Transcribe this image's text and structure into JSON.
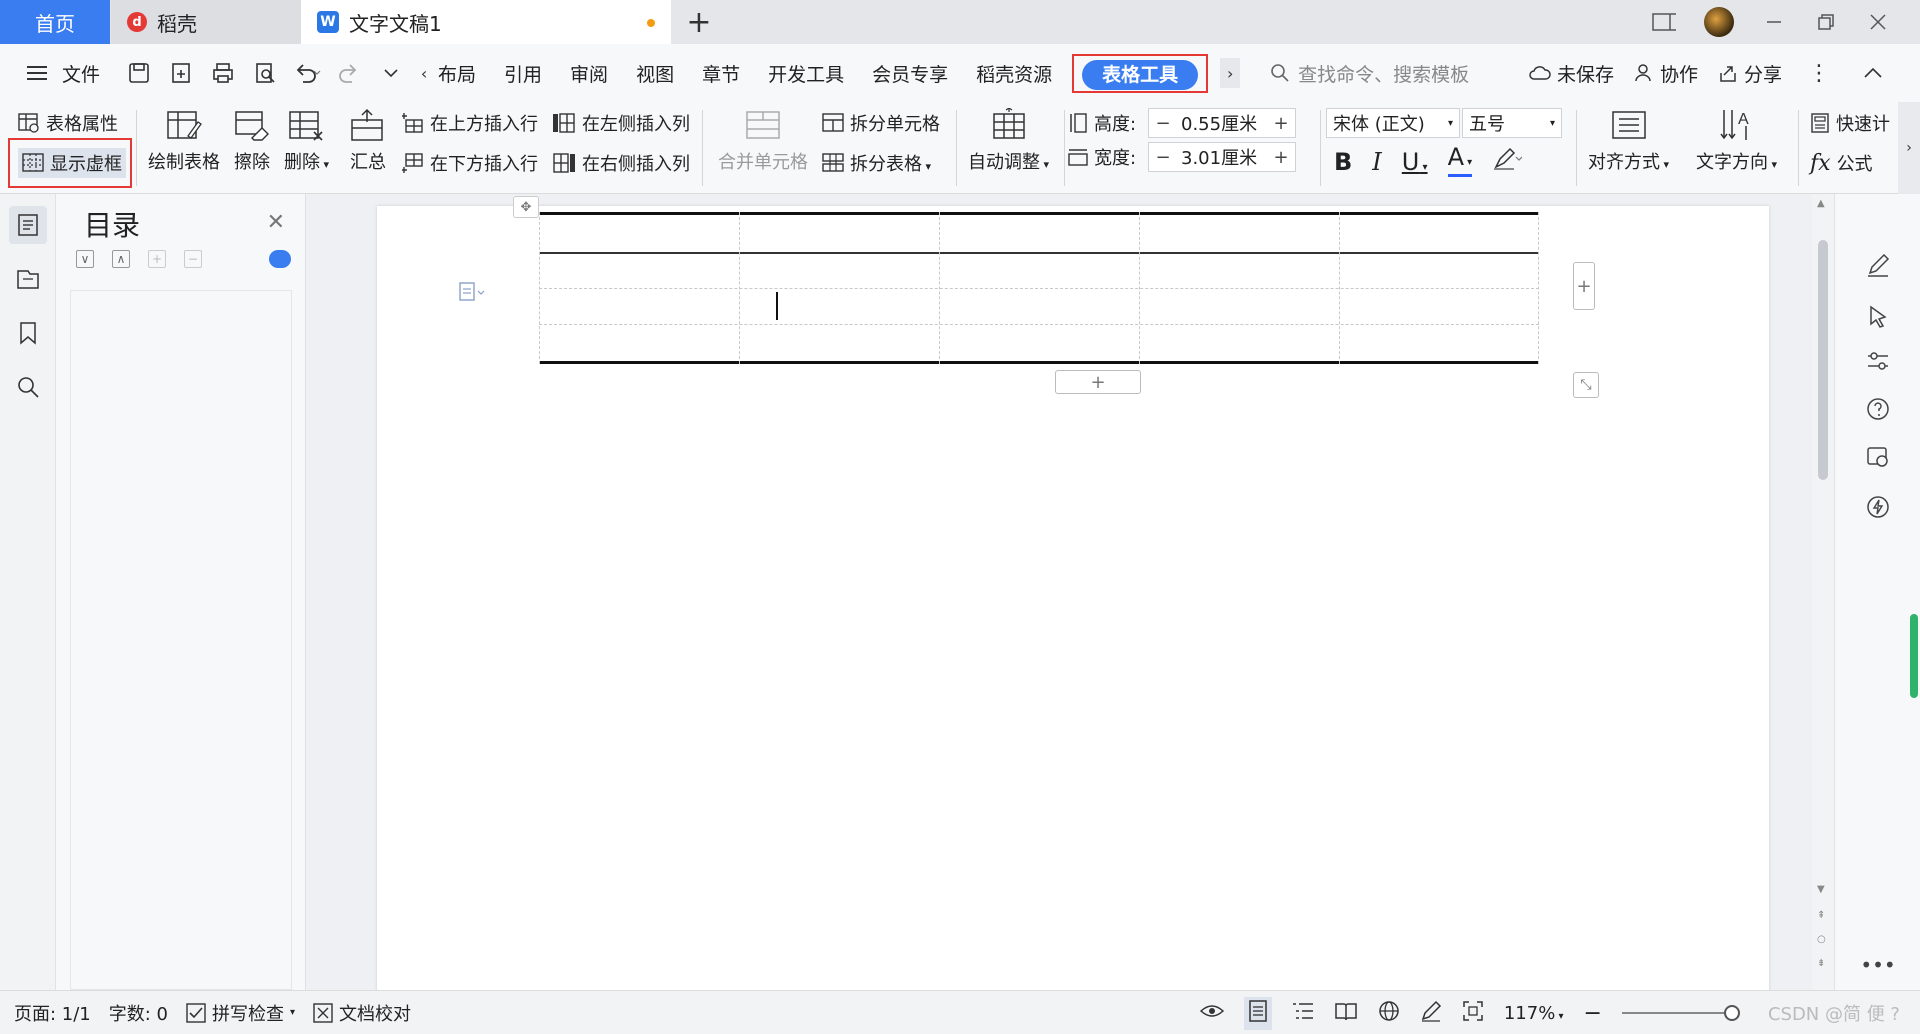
{
  "titlebar": {
    "home_tab": "首页",
    "daoke_tab": "稻壳",
    "doc_tab": "文字文稿1",
    "new_tab_symbol": "+"
  },
  "menubar": {
    "file": "文件",
    "tabs": [
      "布局",
      "引用",
      "审阅",
      "视图",
      "章节",
      "开发工具",
      "会员专享",
      "稻壳资源"
    ],
    "active_tab": "表格工具",
    "search_placeholder": "查找命令、搜索模板",
    "unsaved": "未保存",
    "collab": "协作",
    "share": "分享"
  },
  "ribbon": {
    "table_props": "表格属性",
    "show_gridlines": "显示虚框",
    "draw_table": "绘制表格",
    "erase": "擦除",
    "delete": "删除",
    "summary": "汇总",
    "insert_above": "在上方插入行",
    "insert_below": "在下方插入行",
    "insert_left": "在左侧插入列",
    "insert_right": "在右侧插入列",
    "merge_cells": "合并单元格",
    "split_cells": "拆分单元格",
    "split_table": "拆分表格",
    "auto_fit": "自动调整",
    "height_label": "高度:",
    "height_value": "0.55厘米",
    "width_label": "宽度:",
    "width_value": "3.01厘米",
    "font_name": "宋体 (正文)",
    "font_size": "五号",
    "bold": "B",
    "italic": "I",
    "underline": "U",
    "font_color": "A",
    "align": "对齐方式",
    "text_direction": "文字方向",
    "quick_calc": "快速计",
    "formula": "公式",
    "formula_icon": "fx"
  },
  "outline": {
    "title": "目录"
  },
  "statusbar": {
    "page": "页面: 1/1",
    "words": "字数: 0",
    "spell": "拼写检查",
    "proof": "文档校对",
    "zoom": "117%",
    "watermark": "CSDN @简 便 ?"
  },
  "colors": {
    "accent": "#3a7df0",
    "highlight_box": "#e53935",
    "green": "#2fb36a"
  }
}
